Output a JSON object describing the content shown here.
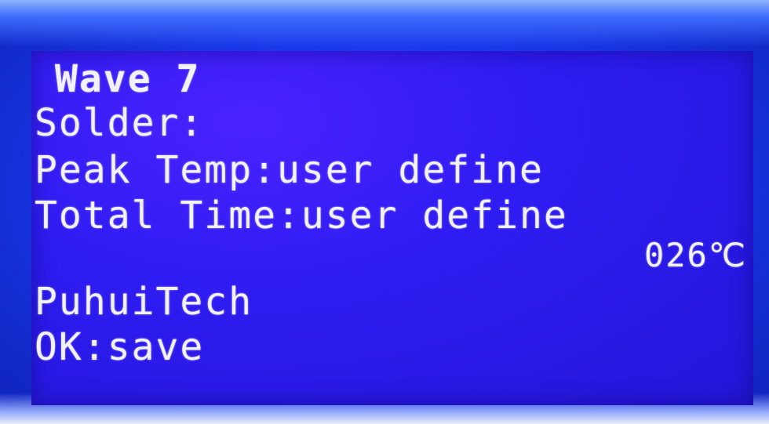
{
  "screen": {
    "title": "Wave 7",
    "solder_label": "Solder:",
    "peak_temp": "Peak Temp:user define",
    "total_time": "Total Time:user define",
    "temperature": "026℃",
    "brand": "PuhuiTech",
    "ok_hint": "OK:save"
  },
  "colors": {
    "lcd_background": "#2f1cf2",
    "text": "#f2f2ff",
    "bezel": "#1f4cff"
  }
}
